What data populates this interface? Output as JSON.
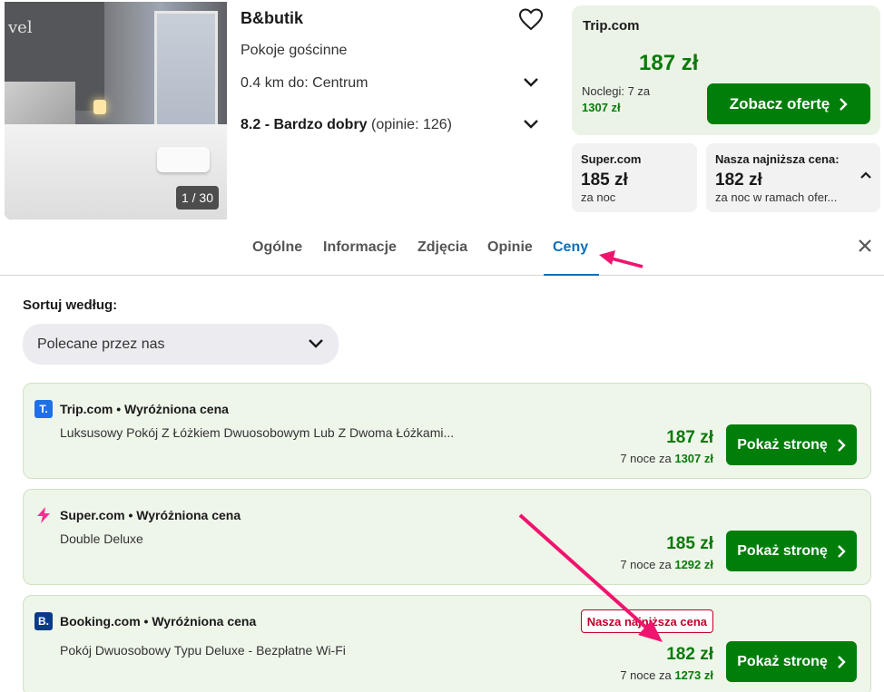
{
  "hotel": {
    "name": "B&butik",
    "room_type": "Pokoje gościnne",
    "distance": "0.4 km do: Centrum",
    "rating_score": "8.2 - Bardzo dobry",
    "rating_count": "(opinie: 126)",
    "photo_logo_text": "vel",
    "photo_counter": "1 / 30"
  },
  "main_offer": {
    "provider": "Trip.com",
    "price": "187 zł",
    "nights_label": "Noclegi: 7 za",
    "nights_total": "1307 zł",
    "cta": "Zobacz ofertę"
  },
  "alt_offers": [
    {
      "provider": "Super.com",
      "price": "185 zł",
      "sub": "za noc"
    },
    {
      "provider": "Nasza najniższa cena:",
      "price": "182 zł",
      "sub": "za noc w ramach ofer..."
    }
  ],
  "tabs": [
    "Ogólne",
    "Informacje",
    "Zdjęcia",
    "Opinie",
    "Ceny"
  ],
  "active_tab": "Ceny",
  "sort": {
    "label": "Sortuj według:",
    "value": "Polecane przez nas"
  },
  "deals": [
    {
      "logo_letter": "T.",
      "logo_color": "#1f6feb",
      "header": "Trip.com • Wyróżniona cena",
      "room": "Luksusowy Pokój Z Łóżkiem Dwuosobowym Lub Z Dwoma Łóżkami...",
      "price": "187 zł",
      "nights": "7 noce za",
      "total": "1307 zł",
      "button": "Pokaż stronę",
      "badge": ""
    },
    {
      "logo_letter": "⚡",
      "logo_color": "#ff2d92",
      "header": "Super.com • Wyróżniona cena",
      "room": "Double Deluxe",
      "price": "185 zł",
      "nights": "7 noce za",
      "total": "1292 zł",
      "button": "Pokaż stronę",
      "badge": ""
    },
    {
      "logo_letter": "B.",
      "logo_color": "#0a3a8a",
      "header": "Booking.com • Wyróżniona cena",
      "room": "Pokój Dwuosobowy Typu Deluxe - Bezpłatne Wi-Fi",
      "price": "182 zł",
      "nights": "7 noce za",
      "total": "1273 zł",
      "button": "Pokaż stronę",
      "badge": "Nasza najniższa cena"
    }
  ],
  "colors": {
    "green_price": "#0a7a0a",
    "cta_green": "#007e0a",
    "tab_active": "#0c6fbb",
    "annotation_arrow": "#f0146e",
    "badge_red": "#c2002a"
  }
}
